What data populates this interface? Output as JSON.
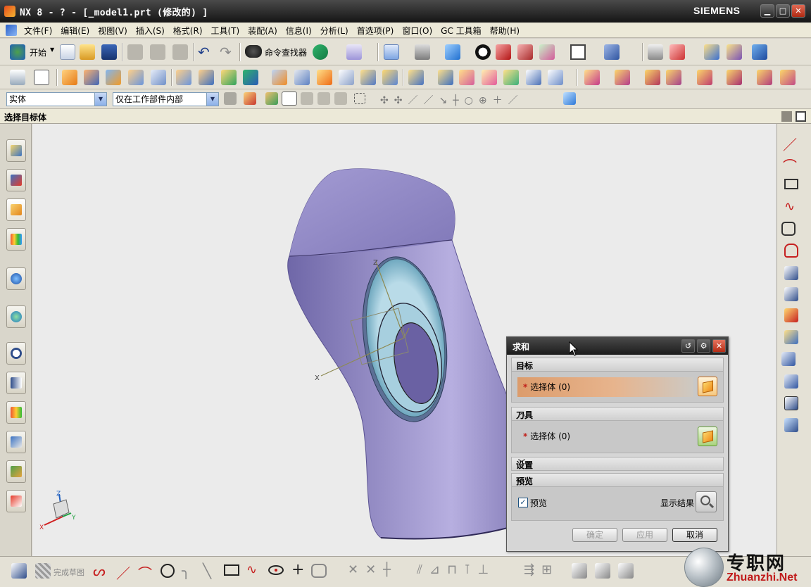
{
  "window": {
    "title": "NX 8 - ? - [_model1.prt  (修改的) ]",
    "brand": "SIEMENS",
    "controls": {
      "minimize": "▁",
      "maximize": "□",
      "close": "✕"
    }
  },
  "menubar": {
    "items": [
      "文件(F)",
      "编辑(E)",
      "视图(V)",
      "插入(S)",
      "格式(R)",
      "工具(T)",
      "装配(A)",
      "信息(I)",
      "分析(L)",
      "首选项(P)",
      "窗口(O)",
      "GC 工具箱",
      "帮助(H)"
    ],
    "mdi_controls": {
      "minimize": "_",
      "restore": "❐",
      "close": "✕"
    }
  },
  "toolbar": {
    "start_label": "开始",
    "command_finder_label": "命令查找器"
  },
  "selection_bar": {
    "type_filter": "实体",
    "scope_filter": "仅在工作部件内部"
  },
  "cue_line": "选择目标体",
  "viewport": {
    "triad_labels": {
      "x": "X",
      "z": "Z",
      "y": "Y"
    }
  },
  "dialog": {
    "title": "求和",
    "target_group": {
      "label": "目标",
      "select_label": "选择体 (0)"
    },
    "tool_group": {
      "label": "刀具",
      "select_label": "选择体 (0)"
    },
    "settings_group": {
      "label": "设置"
    },
    "preview_group": {
      "label": "预览",
      "preview_checkbox_label": "预览",
      "preview_checked": true,
      "show_result_label": "显示结果"
    },
    "buttons": {
      "ok": "确定",
      "apply": "应用",
      "cancel": "取消"
    }
  },
  "bottom_toolbar": {
    "finish_sketch_label": "完成草图"
  },
  "watermark": {
    "cn": "专职网",
    "url": "Zhuanzhi.Net"
  },
  "colors": {
    "body_purple": "#9890c6",
    "dialog_highlight": "#e2a878",
    "title_bar": "#1f1f1f"
  }
}
